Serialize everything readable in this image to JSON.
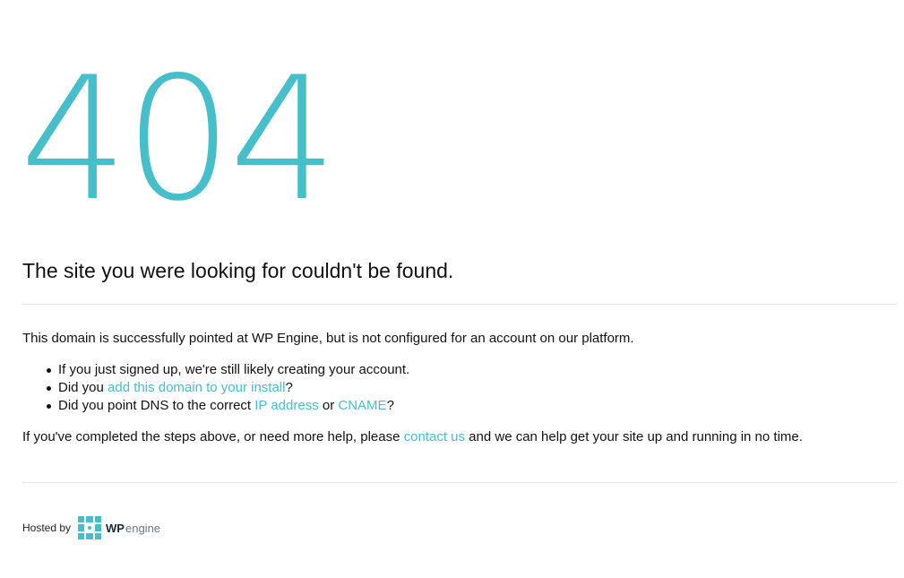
{
  "error": {
    "code": "404",
    "headline": "The site you were looking for couldn't be found."
  },
  "body": {
    "intro": "This domain is successfully pointed at WP Engine, but is not configured for an account on our platform.",
    "steps": [
      {
        "text": "If you just signed up, we're still likely creating your account."
      },
      {
        "prefix": "Did you ",
        "link": "add this domain to your install",
        "suffix": "?"
      },
      {
        "prefix": "Did you point DNS to the correct ",
        "link1": "IP address",
        "middle": " or ",
        "link2": "CNAME",
        "suffix": "?"
      }
    ],
    "help": {
      "prefix": "If you've completed the steps above, or need more help, please ",
      "link": "contact us",
      "suffix": " and we can help get your site up and running in no time."
    }
  },
  "footer": {
    "hosted_by": "Hosted by",
    "logo_wp": "WP",
    "logo_engine": "engine",
    "logo_icon": "wpengine-logo-icon"
  },
  "colors": {
    "accent": "#46bfca",
    "text": "#111111",
    "rule": "#e3e3e3"
  }
}
